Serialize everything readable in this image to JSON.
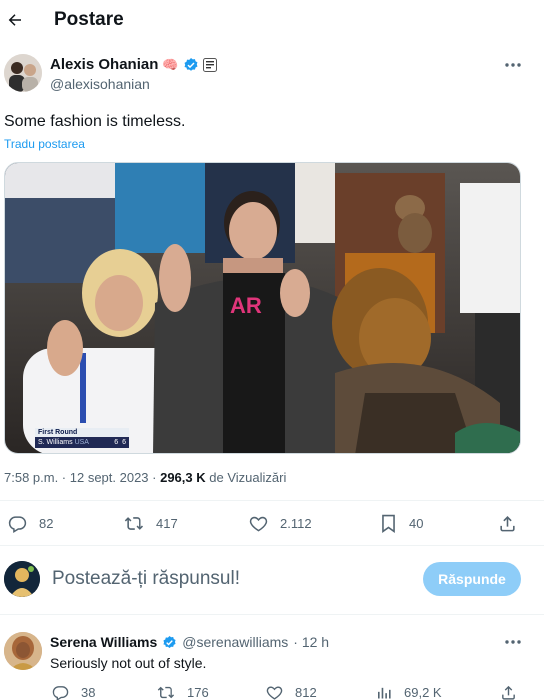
{
  "header": {
    "title": "Postare",
    "back_icon": "arrow-left-icon"
  },
  "post": {
    "author_name": "Alexis Ohanian",
    "author_emoji": "🧠",
    "author_handle": "@alexisohanian",
    "text": "Some fashion is timeless.",
    "translate_label": "Tradu postarea",
    "media_overlay": {
      "round": "First Round",
      "player": "S. Williams",
      "country": "USA",
      "score_1": "6",
      "score_2": "6"
    },
    "meta_time": "7:58 p.m. · 12 sept. 2023 · ",
    "meta_views_count": "296,3 K",
    "meta_views_label": " de Vizualizări",
    "stats": {
      "replies": "82",
      "reposts": "417",
      "likes": "2.112",
      "bookmarks": "40"
    }
  },
  "composer": {
    "placeholder": "Postează-ți răspunsul!",
    "reply_button": "Răspunde"
  },
  "reply": {
    "author_name": "Serena Williams",
    "author_handle": "@serenawilliams",
    "time": "· 12 h",
    "text": "Seriously not out of style.",
    "stats": {
      "replies": "38",
      "reposts": "176",
      "likes": "812",
      "views": "69,2 K"
    }
  },
  "colors": {
    "accent": "#1d9bf0",
    "verified": "#1d9bf0",
    "reply_button_disabled": "#8ecdf8",
    "muted_text": "#536471"
  }
}
